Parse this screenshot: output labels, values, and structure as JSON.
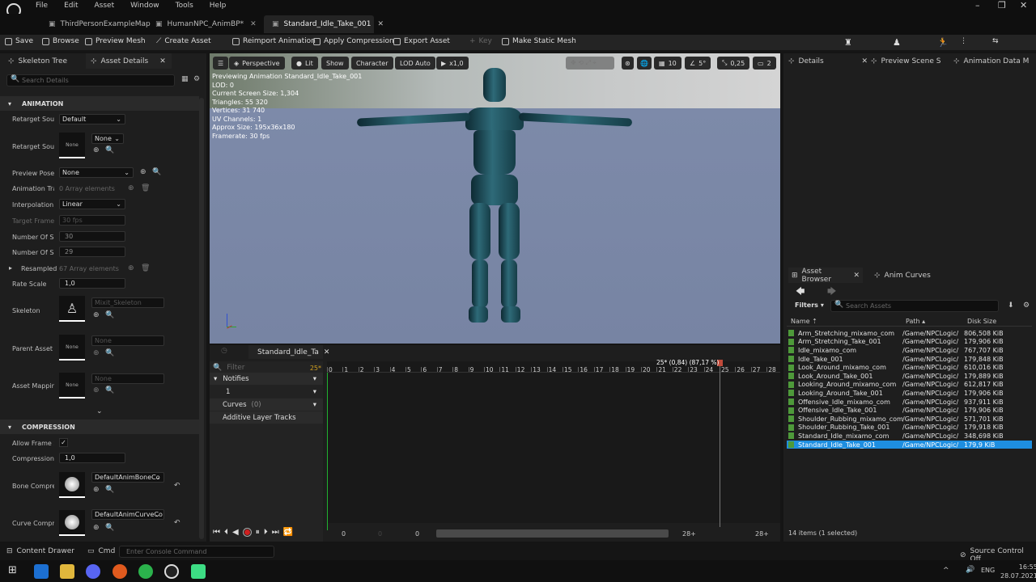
{
  "menu": [
    "File",
    "Edit",
    "Asset",
    "Window",
    "Tools",
    "Help"
  ],
  "doc_tabs": [
    "ThirdPersonExampleMap",
    "HumanNPC_AnimBP*",
    "Standard_Idle_Take_001"
  ],
  "toolbar": {
    "save": "Save",
    "browse": "Browse",
    "preview_mesh": "Preview Mesh",
    "create_asset": "Create Asset",
    "reimport": "Reimport Animation",
    "apply_compression": "Apply Compression",
    "export_asset": "Export Asset",
    "key": "Key",
    "make_static": "Make Static Mesh"
  },
  "left": {
    "tab_skeleton": "Skeleton Tree",
    "tab_details": "Asset Details",
    "search_placeholder": "Search Details",
    "section_animation": "ANIMATION",
    "section_compression": "COMPRESSION",
    "retarget1_label": "Retarget Sourc",
    "retarget1_value": "Default",
    "retarget2_label": "Retarget Sourc",
    "retarget2_thumb": "None",
    "retarget2_value": "None",
    "preview_pose_label": "Preview Pose",
    "preview_pose_value": "None",
    "anim_track_label": "Animation Tra",
    "anim_track_value": "0 Array elements",
    "interp_label": "Interpolation",
    "interp_value": "Linear",
    "target_frame_label": "Target Frame I",
    "target_frame_value": "30 fps",
    "num_frames1_label": "Number Of Sa",
    "num_frames1_value": "30",
    "num_frames2_label": "Number Of Sa",
    "num_frames2_value": "29",
    "resampled_label": "Resampled",
    "resampled_value": "67 Array elements",
    "rate_label": "Rate Scale",
    "rate_value": "1,0",
    "skeleton_label": "Skeleton",
    "skeleton_value": "Mixit_Skeleton",
    "parent_label": "Parent Asset",
    "parent_thumb": "None",
    "parent_value": "None",
    "mapping_label": "Asset Mapping",
    "mapping_thumb": "None",
    "mapping_value": "None",
    "allow_frame_label": "Allow Frame S",
    "compression_e_label": "Compression E",
    "compression_e_value": "1,0",
    "bone_comp_label": "Bone Compres",
    "bone_comp_value": "DefaultAnimBoneCo",
    "curve_comp_label": "Curve Compres",
    "curve_comp_value": "DefaultAnimCurveCo"
  },
  "viewport": {
    "perspective": "Perspective",
    "lit": "Lit",
    "show": "Show",
    "character": "Character",
    "lod": "LOD Auto",
    "speed": "x1,0",
    "grid": "10",
    "angle": "5°",
    "scale": "0,25",
    "cams": "2",
    "stats": [
      "Previewing Animation Standard_Idle_Take_001",
      "LOD: 0",
      "Current Screen Size: 1,304",
      "Triangles: 55 320",
      "Vertices: 31 740",
      "UV Channels: 1",
      "Approx Size: 195x36x180",
      "Framerate: 30 fps"
    ]
  },
  "sequencer": {
    "tab": "Standard_Idle_Ta",
    "filter": "Filter",
    "frame_count": "25*",
    "notifies": "Notifies",
    "notify_track": "1",
    "curves": "Curves",
    "curves_count": "(0)",
    "additive": "Additive Layer Tracks",
    "playhead_label": "25* (0,84) (87,17 %)",
    "ticks": [
      "0",
      "1",
      "2",
      "3",
      "4",
      "5",
      "6",
      "7",
      "8",
      "9",
      "10",
      "11",
      "12",
      "13",
      "14",
      "15",
      "16",
      "17",
      "18",
      "19",
      "20",
      "21",
      "22",
      "23",
      "24",
      "25",
      "26",
      "27",
      "28"
    ],
    "range_start": "0",
    "range_start2": "0",
    "range_mid": "0",
    "range_end": "28+",
    "range_end2": "28+"
  },
  "right": {
    "tab_details": "Details",
    "tab_preview": "Preview Scene S",
    "tab_animdata": "Animation Data M",
    "tab_asset_browser": "Asset Browser",
    "tab_anim_curves": "Anim Curves",
    "filters": "Filters",
    "search_placeholder": "Search Assets",
    "col_name": "Name",
    "col_path": "Path",
    "col_size": "Disk Size",
    "assets": [
      {
        "name": "Arm_Stretching_mixamo_com",
        "path": "/Game/NPCLogic/",
        "size": "806,508 KiB"
      },
      {
        "name": "Arm_Stretching_Take_001",
        "path": "/Game/NPCLogic/",
        "size": "179,906 KiB"
      },
      {
        "name": "Idle_mixamo_com",
        "path": "/Game/NPCLogic/",
        "size": "767,707 KiB"
      },
      {
        "name": "Idle_Take_001",
        "path": "/Game/NPCLogic/",
        "size": "179,848 KiB"
      },
      {
        "name": "Look_Around_mixamo_com",
        "path": "/Game/NPCLogic/",
        "size": "610,016 KiB"
      },
      {
        "name": "Look_Around_Take_001",
        "path": "/Game/NPCLogic/",
        "size": "179,889 KiB"
      },
      {
        "name": "Looking_Around_mixamo_com",
        "path": "/Game/NPCLogic/",
        "size": "612,817 KiB"
      },
      {
        "name": "Looking_Around_Take_001",
        "path": "/Game/NPCLogic/",
        "size": "179,906 KiB"
      },
      {
        "name": "Offensive_Idle_mixamo_com",
        "path": "/Game/NPCLogic/",
        "size": "937,911 KiB"
      },
      {
        "name": "Offensive_Idle_Take_001",
        "path": "/Game/NPCLogic/",
        "size": "179,906 KiB"
      },
      {
        "name": "Shoulder_Rubbing_mixamo_com",
        "path": "/Game/NPCLogic/",
        "size": "571,701 KiB"
      },
      {
        "name": "Shoulder_Rubbing_Take_001",
        "path": "/Game/NPCLogic/",
        "size": "179,918 KiB"
      },
      {
        "name": "Standard_Idle_mixamo_com",
        "path": "/Game/NPCLogic/",
        "size": "348,698 KiB"
      },
      {
        "name": "Standard_Idle_Take_001",
        "path": "/Game/NPCLogic/",
        "size": "179,9 KiB"
      }
    ],
    "items_count": "14 items (1 selected)"
  },
  "status": {
    "content_drawer": "Content Drawer",
    "cmd": "Cmd",
    "console_placeholder": "Enter Console Command",
    "source_control": "Source Control Off"
  },
  "taskbar": {
    "time": "16:55",
    "date": "28.07.2021",
    "lang": "ENG"
  },
  "colors": {
    "accent": "#1e8ee0",
    "asset_icon": "#4e9a3a",
    "record": "#d02020"
  }
}
